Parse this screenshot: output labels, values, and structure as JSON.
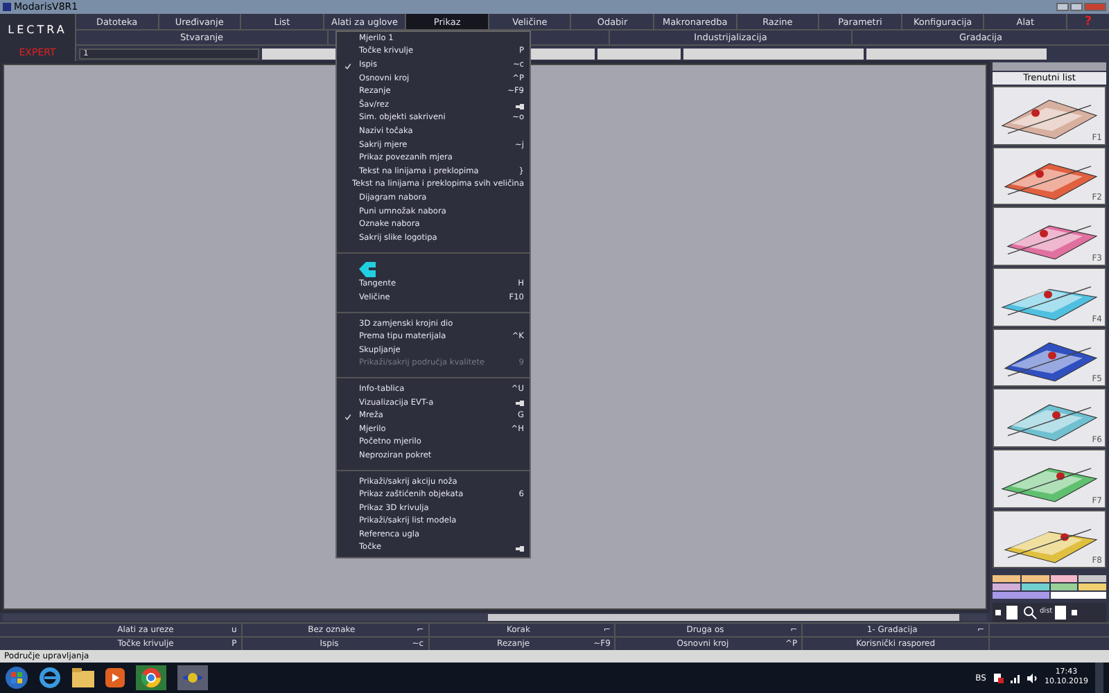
{
  "window": {
    "title": "ModarisV8R1"
  },
  "logo": "LECTRA",
  "mode": "EXPERT",
  "menu_bar": [
    {
      "label": "Datoteka",
      "selected": false
    },
    {
      "label": "Uređivanje",
      "selected": false
    },
    {
      "label": "List",
      "selected": false
    },
    {
      "label": "Alati za uglove",
      "selected": false
    },
    {
      "label": "Prikaz",
      "selected": true
    },
    {
      "label": "Veličine",
      "selected": false
    },
    {
      "label": "Odabir",
      "selected": false
    },
    {
      "label": "Makronaredba",
      "selected": false
    },
    {
      "label": "Razine",
      "selected": false
    },
    {
      "label": "Parametri",
      "selected": false
    },
    {
      "label": "Konfiguracija",
      "selected": false
    },
    {
      "label": "Alat",
      "selected": false
    }
  ],
  "help": "?",
  "sub_bar": [
    "Stvaranje",
    "Industrijalizacija",
    "Gradacija"
  ],
  "input": {
    "value": "1"
  },
  "dropdown": [
    {
      "kind": "item",
      "label": "Mjerilo 1",
      "checked": false,
      "disabled": false
    },
    {
      "kind": "item",
      "label": "Točke krivulje",
      "shortcut": "P",
      "checked": false,
      "disabled": false
    },
    {
      "kind": "item",
      "label": "Ispis",
      "shortcut": "~c",
      "checked": true,
      "disabled": false
    },
    {
      "kind": "item",
      "label": "Osnovni kroj",
      "shortcut": "^P",
      "checked": false,
      "disabled": false
    },
    {
      "kind": "item",
      "label": "Rezanje",
      "shortcut": "~F9",
      "checked": false,
      "disabled": false
    },
    {
      "kind": "item",
      "label": "Šav/rez",
      "submenu": true,
      "checked": false,
      "disabled": false
    },
    {
      "kind": "item",
      "label": "Sim. objekti sakriveni",
      "shortcut": "~o",
      "checked": false,
      "disabled": false
    },
    {
      "kind": "item",
      "label": "Nazivi točaka",
      "checked": false,
      "disabled": false
    },
    {
      "kind": "item",
      "label": "Sakrij mjere",
      "shortcut": "~j",
      "checked": false,
      "disabled": false
    },
    {
      "kind": "item",
      "label": "Prikaz povezanih mjera",
      "checked": false,
      "disabled": false
    },
    {
      "kind": "item",
      "label": "Tekst na linijama i preklopima",
      "shortcut": "}",
      "checked": false,
      "disabled": false
    },
    {
      "kind": "item",
      "label": "Tekst na linijama i preklopima svih veličina",
      "checked": false,
      "disabled": false
    },
    {
      "kind": "item",
      "label": "Dijagram nabora",
      "checked": false,
      "disabled": false
    },
    {
      "kind": "item",
      "label": "Puni umnožak nabora",
      "checked": false,
      "disabled": false
    },
    {
      "kind": "item",
      "label": "Oznake nabora",
      "checked": false,
      "disabled": false
    },
    {
      "kind": "item",
      "label": "Sakrij slike logotipa",
      "checked": false,
      "disabled": false
    },
    {
      "kind": "separator"
    },
    {
      "kind": "logo"
    },
    {
      "kind": "item",
      "label": "Tangente",
      "shortcut": "H",
      "checked": false,
      "disabled": false
    },
    {
      "kind": "item",
      "label": "Veličine",
      "shortcut": "F10",
      "checked": false,
      "disabled": false
    },
    {
      "kind": "separator"
    },
    {
      "kind": "item",
      "label": "3D zamjenski krojni dio",
      "checked": false,
      "disabled": false
    },
    {
      "kind": "item",
      "label": "Prema tipu materijala",
      "shortcut": "^K",
      "checked": false,
      "disabled": false
    },
    {
      "kind": "item",
      "label": "Skupljanje",
      "checked": false,
      "disabled": false
    },
    {
      "kind": "item",
      "label": "Prikaži/sakrij područja kvalitete",
      "shortcut": "9",
      "checked": false,
      "disabled": true
    },
    {
      "kind": "separator"
    },
    {
      "kind": "item",
      "label": "Info-tablica",
      "shortcut": "^U",
      "checked": false,
      "disabled": false
    },
    {
      "kind": "item",
      "label": "Vizualizacija EVT-a",
      "submenu": true,
      "checked": false,
      "disabled": false
    },
    {
      "kind": "item",
      "label": "Mreža",
      "shortcut": "G",
      "checked": true,
      "disabled": false
    },
    {
      "kind": "item",
      "label": "Mjerilo",
      "shortcut": "^H",
      "checked": false,
      "disabled": false
    },
    {
      "kind": "item",
      "label": "Početno mjerilo",
      "checked": false,
      "disabled": false
    },
    {
      "kind": "item",
      "label": "Neproziran pokret",
      "checked": false,
      "disabled": false
    },
    {
      "kind": "separator"
    },
    {
      "kind": "item",
      "label": "Prikaži/sakrij akciju noža",
      "checked": false,
      "disabled": false
    },
    {
      "kind": "item",
      "label": "Prikaz zaštićenih objekata",
      "shortcut": "6",
      "checked": false,
      "disabled": false
    },
    {
      "kind": "item",
      "label": "Prikaz 3D krivulja",
      "checked": false,
      "disabled": false
    },
    {
      "kind": "item",
      "label": "Prikaži/sakrij list modela",
      "checked": false,
      "disabled": false
    },
    {
      "kind": "item",
      "label": "Referenca ugla",
      "checked": false,
      "disabled": false
    },
    {
      "kind": "item",
      "label": "Točke",
      "submenu": true,
      "checked": false,
      "disabled": false
    }
  ],
  "right_panel": {
    "title": "Trenutni list",
    "thumbnails": [
      {
        "label": "F1"
      },
      {
        "label": "F2"
      },
      {
        "label": "F3"
      },
      {
        "label": "F4"
      },
      {
        "label": "F5"
      },
      {
        "label": "F6"
      },
      {
        "label": "F7"
      },
      {
        "label": "F8"
      }
    ],
    "palette": [
      {
        "color": "#f0c080"
      },
      {
        "color": "#f0c080"
      },
      {
        "color": "#f4b8c8"
      },
      {
        "color": "#c8c8c8"
      },
      {
        "color": "#d0b0d8"
      },
      {
        "color": "#70d0d0"
      },
      {
        "color": "#98d098"
      },
      {
        "color": "#f0d070"
      },
      {
        "color": "#a898e8"
      },
      {
        "color": "#ffffff"
      }
    ],
    "zoom_label": "dist"
  },
  "toolbar_rows": [
    [
      {
        "label": "Alati za ureze",
        "key": "u"
      },
      {
        "label": "Bez oznake",
        "key": "⌐"
      },
      {
        "label": "Korak",
        "key": "⌐"
      },
      {
        "label": "Druga os",
        "key": "⌐"
      },
      {
        "label": "1- Gradacija",
        "key": "⌐"
      }
    ],
    [
      {
        "label": "Točke krivulje",
        "key": "P"
      },
      {
        "label": "Ispis",
        "key": "~c"
      },
      {
        "label": "Rezanje",
        "key": "~F9"
      },
      {
        "label": "Osnovni kroj",
        "key": "^P"
      },
      {
        "label": "Korisnički raspored"
      }
    ]
  ],
  "status": "Područje upravljanja",
  "taskbar": {
    "language": "BS",
    "time": "17:43",
    "date": "10.10.2019"
  }
}
